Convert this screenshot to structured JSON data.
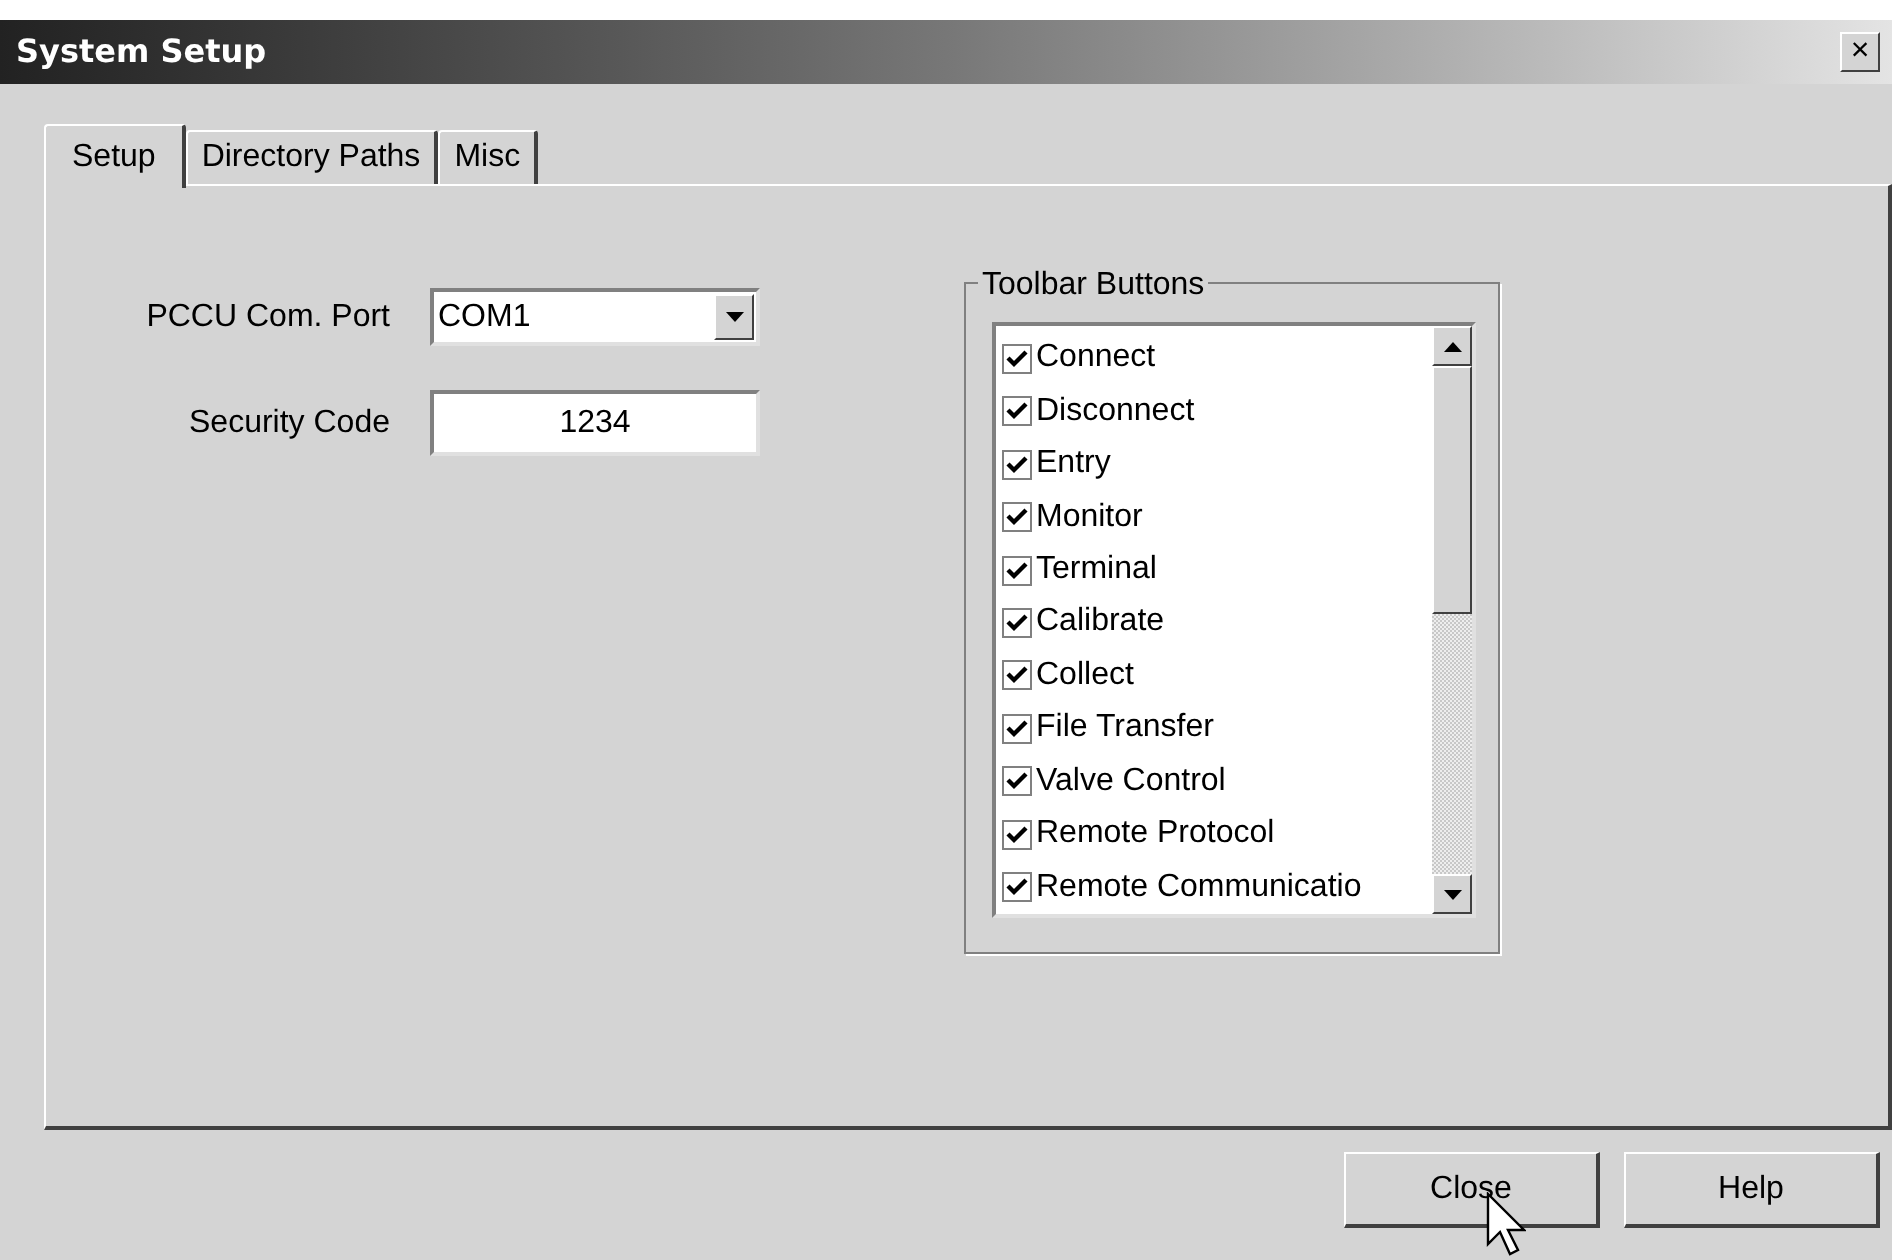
{
  "window": {
    "title": "System Setup",
    "close": "×"
  },
  "tabs": [
    {
      "label": "Setup",
      "selected": true
    },
    {
      "label": "Directory Paths",
      "selected": false
    },
    {
      "label": "Misc",
      "selected": false
    }
  ],
  "fields": [
    {
      "kind": "combo",
      "label": "PCCU Com. Port",
      "value": "COM1"
    },
    {
      "kind": "text",
      "label": "Security Code",
      "value": "1234"
    }
  ],
  "toolbar_buttons": {
    "title": "Toolbar Buttons",
    "items": [
      {
        "label": "Connect",
        "checked": true
      },
      {
        "label": "Disconnect",
        "checked": true
      },
      {
        "label": "Entry",
        "checked": true
      },
      {
        "label": "Monitor",
        "checked": true
      },
      {
        "label": "Terminal",
        "checked": true
      },
      {
        "label": "Calibrate",
        "checked": true
      },
      {
        "label": "Collect",
        "checked": true
      },
      {
        "label": "File Transfer",
        "checked": true
      },
      {
        "label": "Valve Control",
        "checked": true
      },
      {
        "label": "Remote Protocol",
        "checked": true
      },
      {
        "label": "Remote Communicatio",
        "checked": true
      }
    ]
  },
  "buttons": [
    "Close",
    "Help"
  ]
}
